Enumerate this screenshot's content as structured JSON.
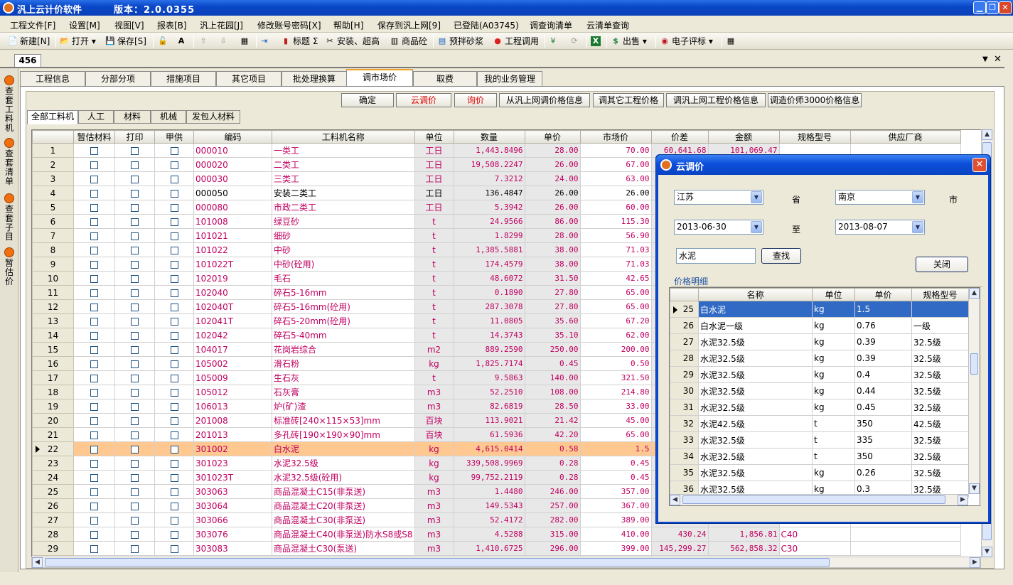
{
  "app": {
    "title": "汎上云计价软件",
    "version": "版本：2.0.0355"
  },
  "menu": [
    "工程文件[F]",
    "设置[M]",
    "视图[V]",
    "报表[B]",
    "汎上花园[J]",
    "修改账号密码[X]",
    "帮助[H]",
    "保存到汎上网[9]",
    "已登陆(A03745)",
    "调查询清单",
    "云清单查询"
  ],
  "toolbar": {
    "new": "新建[N]",
    "open": "打开",
    "save": "保存[S]",
    "title": "标题",
    "install": "安装、超高",
    "concrete": "商品砼",
    "mortar": "预拌砂浆",
    "call": "工程调用",
    "sale": "出售",
    "eval": "电子评标"
  },
  "doc_tab": "456",
  "side_tabs": [
    "查套工料机",
    "查套清单",
    "查套子目",
    "暂估价"
  ],
  "tabs": [
    "工程信息",
    "分部分项",
    "措施项目",
    "其它项目",
    "批处理换算",
    "调市场价",
    "取费",
    "我的业务管理"
  ],
  "actions": [
    "确定",
    "云调价",
    "询价",
    "从汎上网调价格信息",
    "调其它工程价格",
    "调汎上网工程价格信息",
    "调造价师3000价格信息"
  ],
  "filters": [
    "全部工料机",
    "人工",
    "材料",
    "机械",
    "发包人材料"
  ],
  "columns": [
    "暂估材料",
    "打印",
    "甲供",
    "编码",
    "工料机名称",
    "单位",
    "数量",
    "单价",
    "市场价",
    "价差",
    "金额",
    "规格型号",
    "供应厂商"
  ],
  "rows": [
    {
      "n": "1",
      "code": "000010",
      "name": "一类工",
      "unit": "工日",
      "qty": "1,443.8496",
      "price": "28.00",
      "market": "70.00",
      "diff": "60,641.68",
      "amount": "101,069.47",
      "spec": ""
    },
    {
      "n": "2",
      "code": "000020",
      "name": "二类工",
      "unit": "工日",
      "qty": "19,508.2247",
      "price": "26.00",
      "market": "67.00",
      "diff": "",
      "amount": "",
      "spec": ""
    },
    {
      "n": "3",
      "code": "000030",
      "name": "三类工",
      "unit": "工日",
      "qty": "7.3212",
      "price": "24.00",
      "market": "63.00",
      "diff": "",
      "amount": "",
      "spec": ""
    },
    {
      "n": "4",
      "code": "000050",
      "name": "安装二类工",
      "unit": "工日",
      "qty": "136.4847",
      "price": "26.00",
      "market": "26.00",
      "diff": "",
      "amount": "",
      "spec": "",
      "black": true
    },
    {
      "n": "5",
      "code": "000080",
      "name": "市政二类工",
      "unit": "工日",
      "qty": "5.3942",
      "price": "26.00",
      "market": "60.00",
      "diff": "",
      "amount": "",
      "spec": ""
    },
    {
      "n": "6",
      "code": "101008",
      "name": "绿豆砂",
      "unit": "t",
      "qty": "24.9566",
      "price": "86.00",
      "market": "115.30",
      "diff": "",
      "amount": "",
      "spec": ""
    },
    {
      "n": "7",
      "code": "101021",
      "name": "细砂",
      "unit": "t",
      "qty": "1.8299",
      "price": "28.00",
      "market": "56.90",
      "diff": "",
      "amount": "",
      "spec": ""
    },
    {
      "n": "8",
      "code": "101022",
      "name": "中砂",
      "unit": "t",
      "qty": "1,385.5881",
      "price": "38.00",
      "market": "71.03",
      "diff": "",
      "amount": "",
      "spec": ""
    },
    {
      "n": "9",
      "code": "101022T",
      "name": "中砂(砼用)",
      "unit": "t",
      "qty": "174.4579",
      "price": "38.00",
      "market": "71.03",
      "diff": "",
      "amount": "",
      "spec": ""
    },
    {
      "n": "10",
      "code": "102019",
      "name": "毛石",
      "unit": "t",
      "qty": "48.6072",
      "price": "31.50",
      "market": "42.65",
      "diff": "",
      "amount": "",
      "spec": ""
    },
    {
      "n": "11",
      "code": "102040",
      "name": "碎石5-16mm",
      "unit": "t",
      "qty": "0.1890",
      "price": "27.80",
      "market": "65.00",
      "diff": "",
      "amount": "",
      "spec": ""
    },
    {
      "n": "12",
      "code": "102040T",
      "name": "碎石5-16mm(砼用)",
      "unit": "t",
      "qty": "287.3078",
      "price": "27.80",
      "market": "65.00",
      "diff": "",
      "amount": "",
      "spec": ""
    },
    {
      "n": "13",
      "code": "102041T",
      "name": "碎石5-20mm(砼用)",
      "unit": "t",
      "qty": "11.0805",
      "price": "35.60",
      "market": "67.20",
      "diff": "",
      "amount": "",
      "spec": ""
    },
    {
      "n": "14",
      "code": "102042",
      "name": "碎石5-40mm",
      "unit": "t",
      "qty": "14.3743",
      "price": "35.10",
      "market": "62.00",
      "diff": "",
      "amount": "",
      "spec": ""
    },
    {
      "n": "15",
      "code": "104017",
      "name": "花岗岩综合",
      "unit": "m2",
      "qty": "889.2590",
      "price": "250.00",
      "market": "200.00",
      "diff": "",
      "amount": "",
      "spec": ""
    },
    {
      "n": "16",
      "code": "105002",
      "name": "滑石粉",
      "unit": "kg",
      "qty": "1,825.7174",
      "price": "0.45",
      "market": "0.50",
      "diff": "",
      "amount": "",
      "spec": ""
    },
    {
      "n": "17",
      "code": "105009",
      "name": "生石灰",
      "unit": "t",
      "qty": "9.5863",
      "price": "140.00",
      "market": "321.50",
      "diff": "",
      "amount": "",
      "spec": ""
    },
    {
      "n": "18",
      "code": "105012",
      "name": "石灰膏",
      "unit": "m3",
      "qty": "52.2510",
      "price": "108.00",
      "market": "214.80",
      "diff": "",
      "amount": "",
      "spec": ""
    },
    {
      "n": "19",
      "code": "106013",
      "name": "炉(矿)渣",
      "unit": "m3",
      "qty": "82.6819",
      "price": "28.50",
      "market": "33.00",
      "diff": "",
      "amount": "",
      "spec": ""
    },
    {
      "n": "20",
      "code": "201008",
      "name": "标准砖[240×115×53]mm",
      "unit": "百块",
      "qty": "113.9021",
      "price": "21.42",
      "market": "45.00",
      "diff": "",
      "amount": "",
      "spec": ""
    },
    {
      "n": "21",
      "code": "201013",
      "name": "多孔砖[190×190×90]mm",
      "unit": "百块",
      "qty": "61.5936",
      "price": "42.20",
      "market": "65.00",
      "diff": "",
      "amount": "",
      "spec": ""
    },
    {
      "n": "22",
      "code": "301002",
      "name": "白水泥",
      "unit": "kg",
      "qty": "4,615.0414",
      "price": "0.58",
      "market": "1.5",
      "diff": "",
      "amount": "",
      "spec": "",
      "sel": true
    },
    {
      "n": "23",
      "code": "301023",
      "name": "水泥32.5级",
      "unit": "kg",
      "qty": "339,508.9969",
      "price": "0.28",
      "market": "0.45",
      "diff": "",
      "amount": "",
      "spec": ""
    },
    {
      "n": "24",
      "code": "301023T",
      "name": "水泥32.5级(砼用)",
      "unit": "kg",
      "qty": "99,752.2119",
      "price": "0.28",
      "market": "0.45",
      "diff": "",
      "amount": "",
      "spec": ""
    },
    {
      "n": "25",
      "code": "303063",
      "name": "商品混凝土C15(非泵送)",
      "unit": "m3",
      "qty": "1.4480",
      "price": "246.00",
      "market": "357.00",
      "diff": "",
      "amount": "",
      "spec": ""
    },
    {
      "n": "26",
      "code": "303064",
      "name": "商品混凝土C20(非泵送)",
      "unit": "m3",
      "qty": "149.5343",
      "price": "257.00",
      "market": "367.00",
      "diff": "",
      "amount": "",
      "spec": ""
    },
    {
      "n": "27",
      "code": "303066",
      "name": "商品混凝土C30(非泵送)",
      "unit": "m3",
      "qty": "52.4172",
      "price": "282.00",
      "market": "389.00",
      "diff": "",
      "amount": "",
      "spec": ""
    },
    {
      "n": "28",
      "code": "303076",
      "name": "商品混凝土C40(非泵送)防水S8或S8",
      "unit": "m3",
      "qty": "4.5288",
      "price": "315.00",
      "market": "410.00",
      "diff": "430.24",
      "amount": "1,856.81",
      "spec": "C40"
    },
    {
      "n": "29",
      "code": "303083",
      "name": "商品混凝土C30(泵送)",
      "unit": "m3",
      "qty": "1,410.6725",
      "price": "296.00",
      "market": "399.00",
      "diff": "145,299.27",
      "amount": "562,858.32",
      "spec": "C30"
    }
  ],
  "dialog": {
    "title": "云调价",
    "province": "江苏",
    "province_label": "省",
    "city": "南京",
    "city_label": "市",
    "date_from": "2013-06-30",
    "to_label": "至",
    "date_to": "2013-08-07",
    "search_value": "水泥",
    "search_btn": "查找",
    "close_btn": "关闭",
    "section": "价格明细",
    "columns": [
      "名称",
      "单位",
      "单价",
      "规格型号"
    ],
    "rows": [
      {
        "n": "25",
        "name": "白水泥",
        "unit": "kg",
        "price": "1.5",
        "spec": "",
        "sel": true
      },
      {
        "n": "26",
        "name": "白水泥一级",
        "unit": "kg",
        "price": "0.76",
        "spec": "一级"
      },
      {
        "n": "27",
        "name": "水泥32.5级",
        "unit": "kg",
        "price": "0.39",
        "spec": "32.5级"
      },
      {
        "n": "28",
        "name": "水泥32.5级",
        "unit": "kg",
        "price": "0.39",
        "spec": "32.5级"
      },
      {
        "n": "29",
        "name": "水泥32.5级",
        "unit": "kg",
        "price": "0.4",
        "spec": "32.5级"
      },
      {
        "n": "30",
        "name": "水泥32.5级",
        "unit": "kg",
        "price": "0.44",
        "spec": "32.5级"
      },
      {
        "n": "31",
        "name": "水泥32.5级",
        "unit": "kg",
        "price": "0.45",
        "spec": "32.5级"
      },
      {
        "n": "32",
        "name": "水泥42.5级",
        "unit": "t",
        "price": "350",
        "spec": "42.5级"
      },
      {
        "n": "33",
        "name": "水泥32.5级",
        "unit": "t",
        "price": "335",
        "spec": "32.5级"
      },
      {
        "n": "34",
        "name": "水泥32.5级",
        "unit": "t",
        "price": "350",
        "spec": "32.5级"
      },
      {
        "n": "35",
        "name": "水泥32.5级",
        "unit": "kg",
        "price": "0.26",
        "spec": "32.5级"
      },
      {
        "n": "36",
        "name": "水泥32.5级",
        "unit": "kg",
        "price": "0.3",
        "spec": "32.5级"
      }
    ]
  }
}
